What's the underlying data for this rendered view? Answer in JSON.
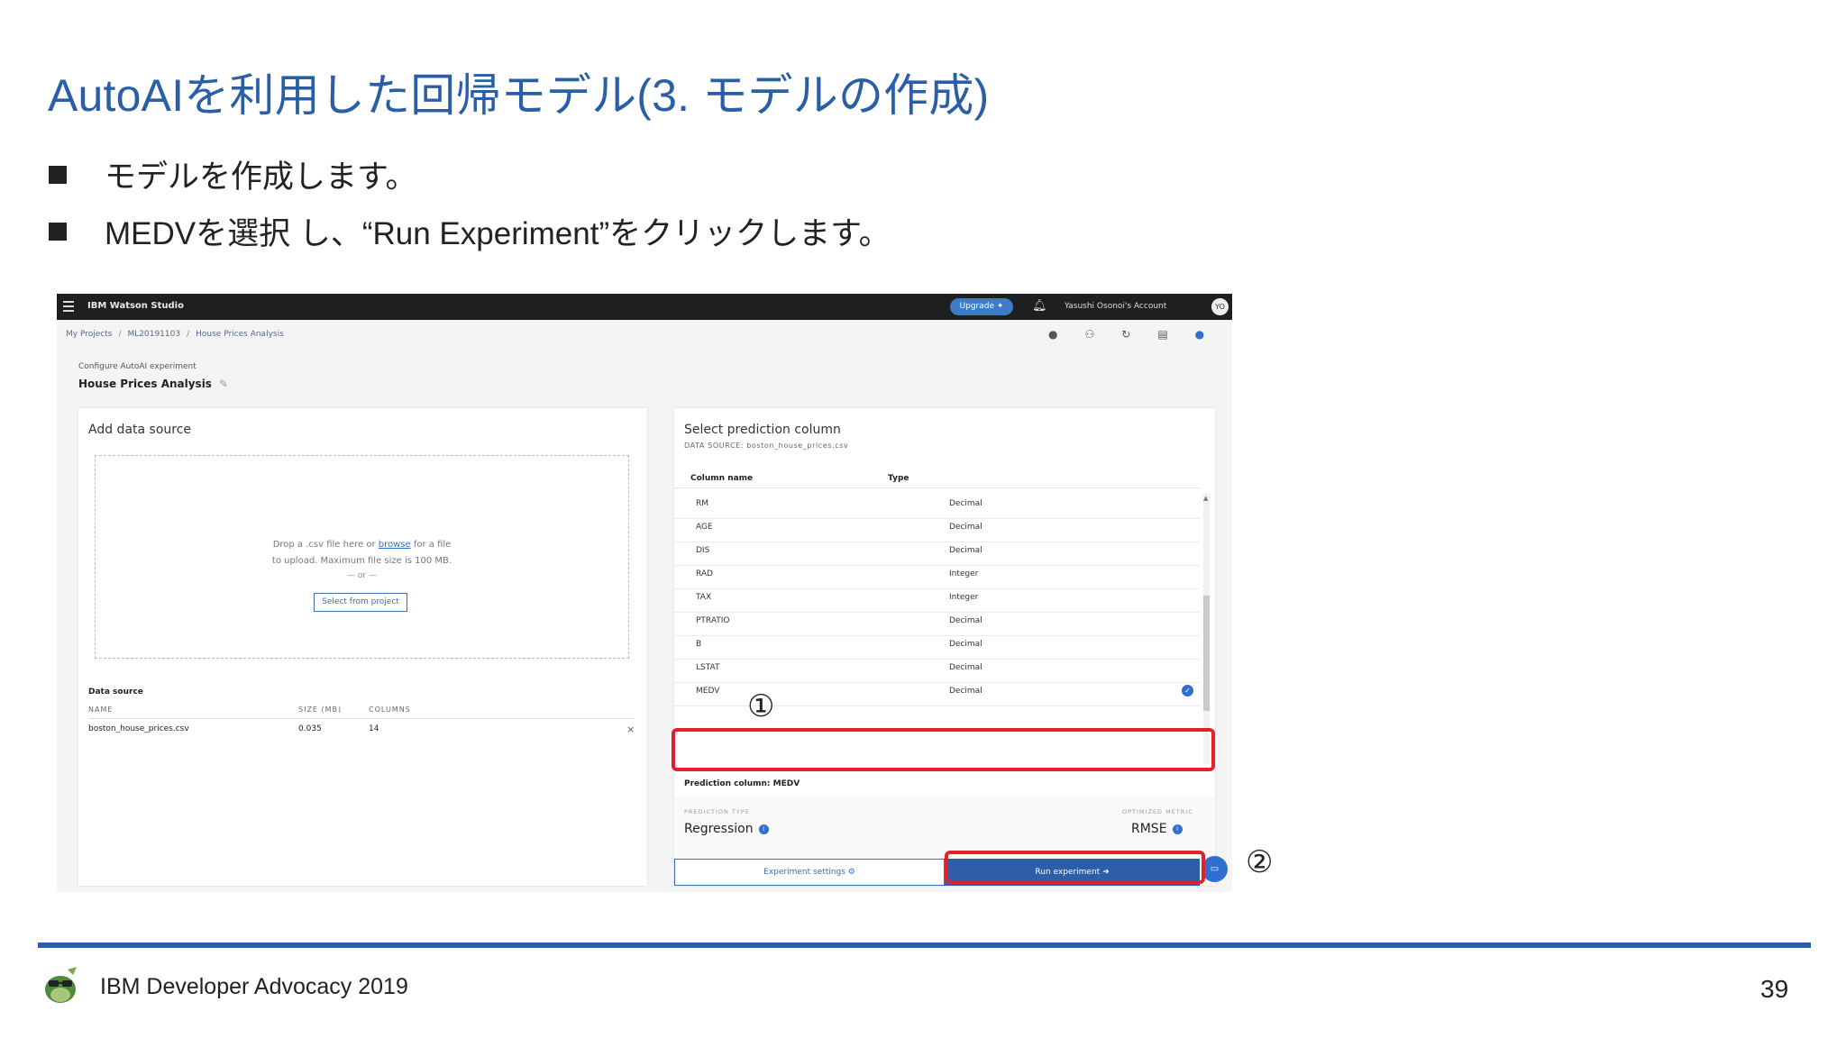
{
  "slide": {
    "title": "AutoAIを利用した回帰モデル(3. モデルの作成)",
    "bullets": [
      "モデルを作成します。",
      "MEDVを選択 し、“Run Experiment”をクリックします。"
    ],
    "callouts": [
      "①",
      "②"
    ],
    "footer": "IBM Developer Advocacy 2019",
    "page_number": "39",
    "accent_color": "#2b5fa5",
    "highlight_color": "#e4212b"
  },
  "app": {
    "brand": "IBM Watson Studio",
    "upgrade_label": "Upgrade ✦",
    "account": "Yasushi Osonoi's Account",
    "avatar_initials": "YO",
    "breadcrumb": [
      "My Projects",
      "ML20191103",
      "House Prices Analysis"
    ],
    "config_label": "Configure AutoAI experiment",
    "experiment_name": "House Prices Analysis",
    "left_panel": {
      "heading": "Add data source",
      "drop_line1_pre": "Drop a .csv file here or ",
      "drop_link": "browse",
      "drop_line1_post": " for a file",
      "drop_line2": "to upload. Maximum file size is 100 MB.",
      "or_label": "— or —",
      "select_button": "Select from project",
      "data_source_title": "Data source",
      "headers": {
        "name": "NAME",
        "size": "SIZE (MB)",
        "columns": "COLUMNS"
      },
      "file": {
        "name": "boston_house_prices.csv",
        "size": "0.035",
        "columns": "14"
      }
    },
    "right_panel": {
      "heading": "Select prediction column",
      "data_source_label": "DATA SOURCE: boston_house_prices.csv",
      "col_header_name": "Column name",
      "col_header_type": "Type",
      "rows": [
        {
          "name": "RM",
          "type": "Decimal"
        },
        {
          "name": "AGE",
          "type": "Decimal"
        },
        {
          "name": "DIS",
          "type": "Decimal"
        },
        {
          "name": "RAD",
          "type": "Integer"
        },
        {
          "name": "TAX",
          "type": "Integer"
        },
        {
          "name": "PTRATIO",
          "type": "Decimal"
        },
        {
          "name": "B",
          "type": "Decimal"
        },
        {
          "name": "LSTAT",
          "type": "Decimal"
        },
        {
          "name": "MEDV",
          "type": "Decimal"
        }
      ],
      "selected_row": "MEDV",
      "prediction_column": "Prediction column: MEDV",
      "prediction_type_label": "PREDICTION TYPE",
      "prediction_type": "Regression",
      "metric_label": "OPTIMIZED METRIC",
      "metric": "RMSE",
      "settings_button": "Experiment settings ⚙",
      "run_button": "Run experiment ➜"
    }
  }
}
